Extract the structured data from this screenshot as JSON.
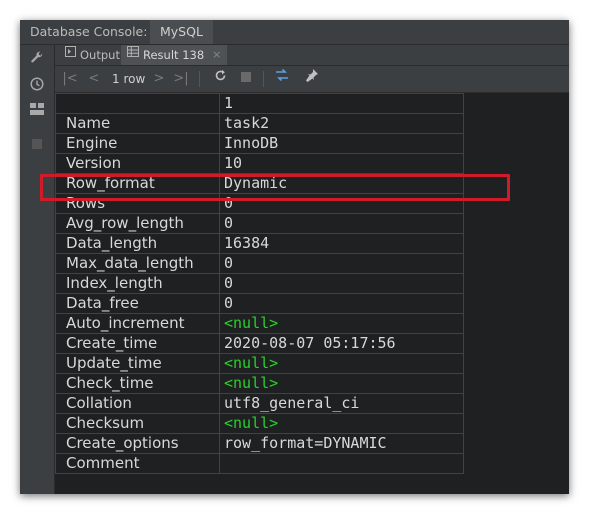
{
  "titlebar": {
    "title": "Database Console:",
    "db_tab": "MySQL"
  },
  "tabs": [
    {
      "label": "Output",
      "icon": "output-icon"
    },
    {
      "label": "Result 138",
      "icon": "table-icon",
      "close": "×"
    }
  ],
  "toolbar": {
    "row_count": "1 row"
  },
  "table": {
    "header_value": "1",
    "rows": [
      {
        "key": "Name",
        "value": "task2"
      },
      {
        "key": "Engine",
        "value": "InnoDB"
      },
      {
        "key": "Version",
        "value": "10"
      },
      {
        "key": "Row_format",
        "value": "Dynamic"
      },
      {
        "key": "Rows",
        "value": "0"
      },
      {
        "key": "Avg_row_length",
        "value": "0"
      },
      {
        "key": "Data_length",
        "value": "16384"
      },
      {
        "key": "Max_data_length",
        "value": "0"
      },
      {
        "key": "Index_length",
        "value": "0"
      },
      {
        "key": "Data_free",
        "value": "0"
      },
      {
        "key": "Auto_increment",
        "value": "<null>"
      },
      {
        "key": "Create_time",
        "value": "2020-08-07 05:17:56"
      },
      {
        "key": "Update_time",
        "value": "<null>"
      },
      {
        "key": "Check_time",
        "value": "<null>"
      },
      {
        "key": "Collation",
        "value": "utf8_general_ci"
      },
      {
        "key": "Checksum",
        "value": "<null>"
      },
      {
        "key": "Create_options",
        "value": "row_format=DYNAMIC"
      },
      {
        "key": "Comment",
        "value": ""
      }
    ]
  },
  "colors": {
    "null_value": "#2ad12a",
    "highlight_box": "#d11a2a",
    "grid_line": "#2a35c8"
  }
}
